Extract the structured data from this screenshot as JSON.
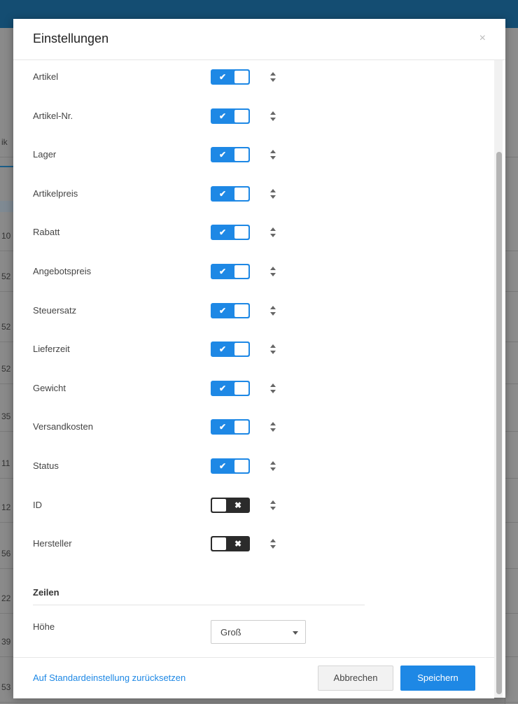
{
  "modal": {
    "title": "Einstellungen",
    "close_glyph": "×"
  },
  "columns": [
    {
      "label": "Artikel",
      "enabled": true
    },
    {
      "label": "Artikel-Nr.",
      "enabled": true
    },
    {
      "label": "Lager",
      "enabled": true
    },
    {
      "label": "Artikelpreis",
      "enabled": true
    },
    {
      "label": "Rabatt",
      "enabled": true
    },
    {
      "label": "Angebotspreis",
      "enabled": true
    },
    {
      "label": "Steuersatz",
      "enabled": true
    },
    {
      "label": "Lieferzeit",
      "enabled": true
    },
    {
      "label": "Gewicht",
      "enabled": true
    },
    {
      "label": "Versandkosten",
      "enabled": true
    },
    {
      "label": "Status",
      "enabled": true
    },
    {
      "label": "ID",
      "enabled": false
    },
    {
      "label": "Hersteller",
      "enabled": false
    }
  ],
  "toggle_marks": {
    "on": "✔",
    "off": "✖"
  },
  "rows_section": {
    "title": "Zeilen",
    "height_label": "Höhe",
    "height_value": "Groß"
  },
  "footer": {
    "reset_label": "Auf Standardeinstellung zurücksetzen",
    "cancel_label": "Abbrechen",
    "save_label": "Speichern"
  },
  "background_fragments": [
    "ik",
    "10",
    "52",
    "52",
    "52",
    "35",
    "11",
    "12",
    "56",
    "22",
    "39",
    "53"
  ],
  "colors": {
    "accent": "#1e88e5",
    "toggle_off": "#2b2b2b",
    "backdrop_topbar": "#144d72"
  },
  "icons": {
    "close": "close-icon",
    "check": "check-icon",
    "x": "x-icon",
    "sort": "sort-handle-icon",
    "caret": "caret-down-icon"
  }
}
